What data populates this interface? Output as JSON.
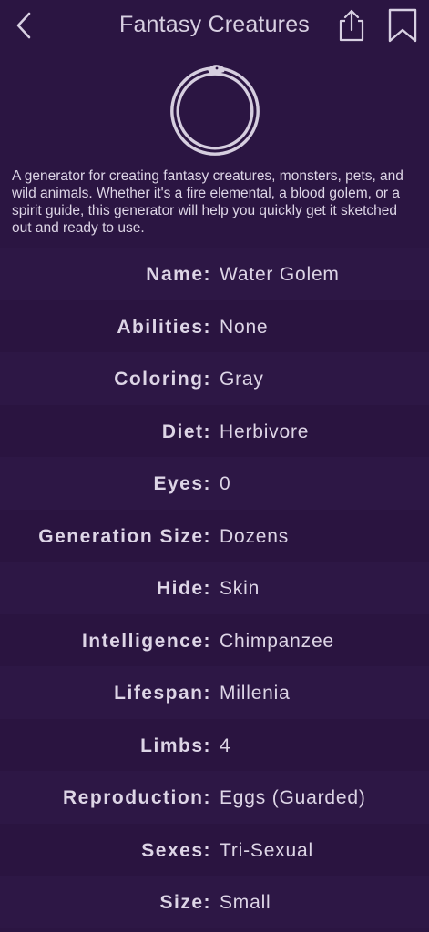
{
  "header": {
    "title": "Fantasy Creatures",
    "back_icon": "chevron-left-icon",
    "share_icon": "share-icon",
    "bookmark_icon": "bookmark-icon"
  },
  "logo": {
    "icon": "ouroboros-icon"
  },
  "description": "A generator for creating fantasy creatures, monsters, pets, and wild animals. Whether it's a fire elemental, a blood golem, or a spirit guide, this generator will help you quickly get it sketched out and ready to use.",
  "attributes": [
    {
      "label": "Name:",
      "value": "Water Golem"
    },
    {
      "label": "Abilities:",
      "value": "None"
    },
    {
      "label": "Coloring:",
      "value": "Gray"
    },
    {
      "label": "Diet:",
      "value": "Herbivore"
    },
    {
      "label": "Eyes:",
      "value": "0"
    },
    {
      "label": "Generation Size:",
      "value": "Dozens"
    },
    {
      "label": "Hide:",
      "value": "Skin"
    },
    {
      "label": "Intelligence:",
      "value": "Chimpanzee"
    },
    {
      "label": "Lifespan:",
      "value": "Millenia"
    },
    {
      "label": "Limbs:",
      "value": "4"
    },
    {
      "label": "Reproduction:",
      "value": "Eggs (Guarded)"
    },
    {
      "label": "Sexes:",
      "value": "Tri-Sexual"
    },
    {
      "label": "Size:",
      "value": "Small"
    }
  ],
  "colors": {
    "background": "#2b1542",
    "text": "#ddd5e6"
  }
}
